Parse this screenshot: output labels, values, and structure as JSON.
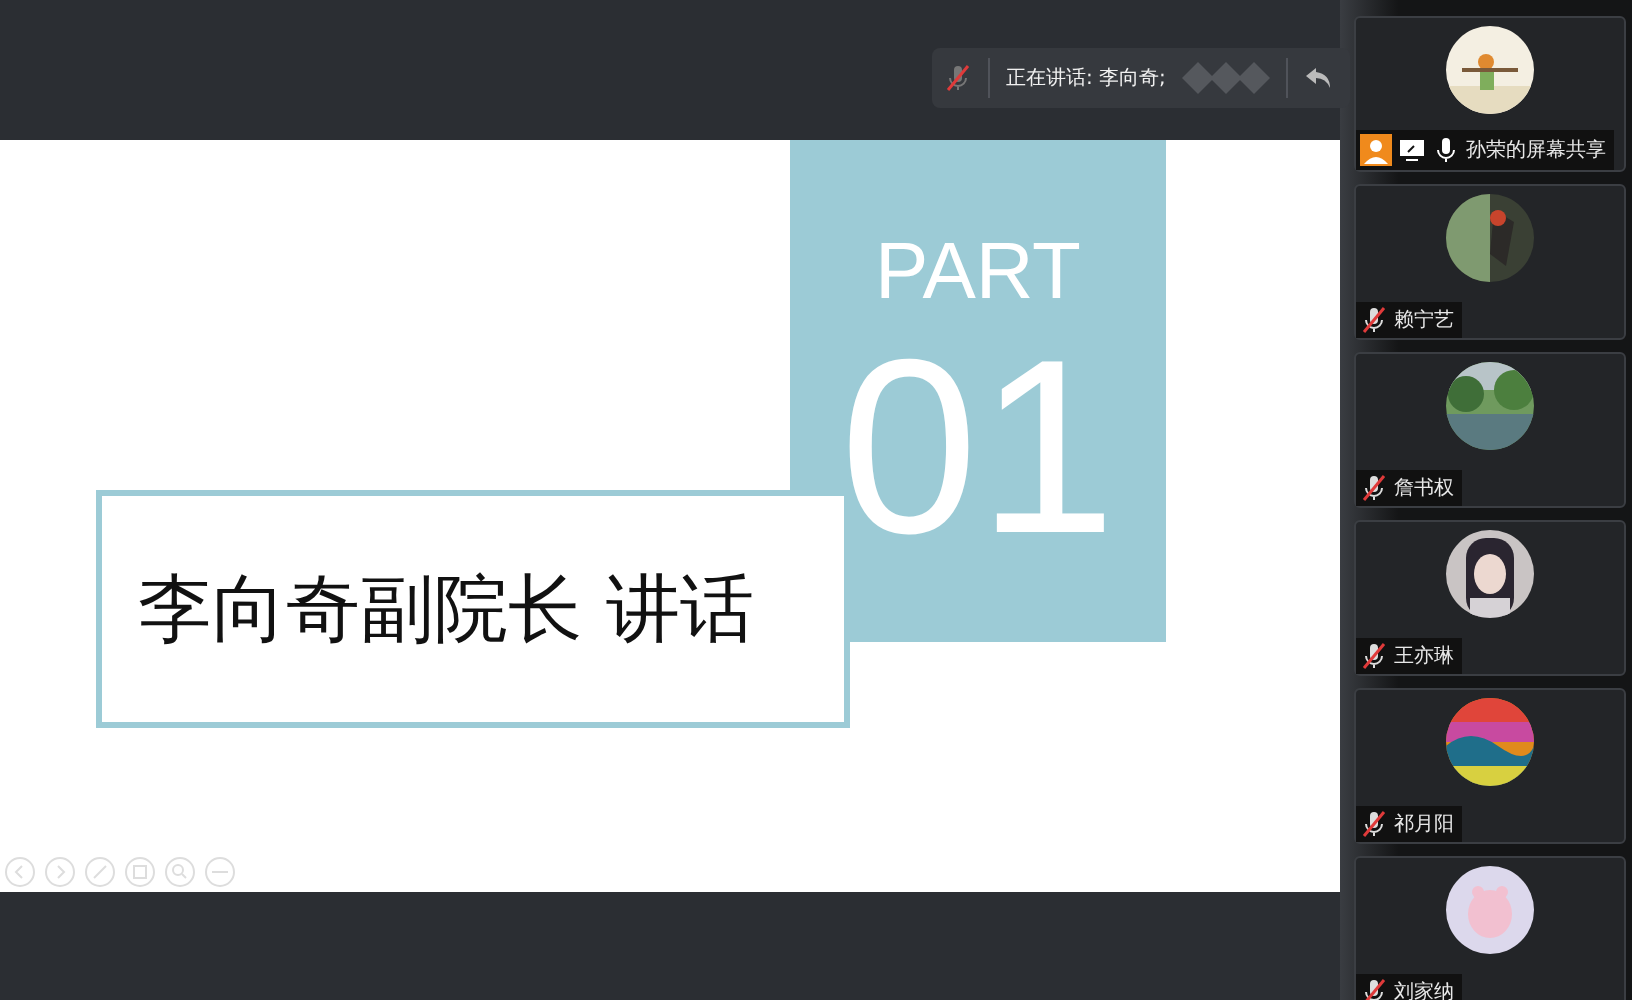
{
  "speaker": {
    "label": "正在讲话: 李向奇;"
  },
  "slide": {
    "part": "PART",
    "number": "01",
    "title": "李向奇副院长 讲话"
  },
  "participants": [
    {
      "name": "孙荣的屏幕共享",
      "muted": false,
      "sharing": true
    },
    {
      "name": "赖宁艺",
      "muted": true,
      "sharing": false
    },
    {
      "name": "詹书权",
      "muted": true,
      "sharing": false
    },
    {
      "name": "王亦琳",
      "muted": true,
      "sharing": false
    },
    {
      "name": "祁月阳",
      "muted": true,
      "sharing": false
    },
    {
      "name": "刘家纳",
      "muted": true,
      "sharing": false
    }
  ]
}
